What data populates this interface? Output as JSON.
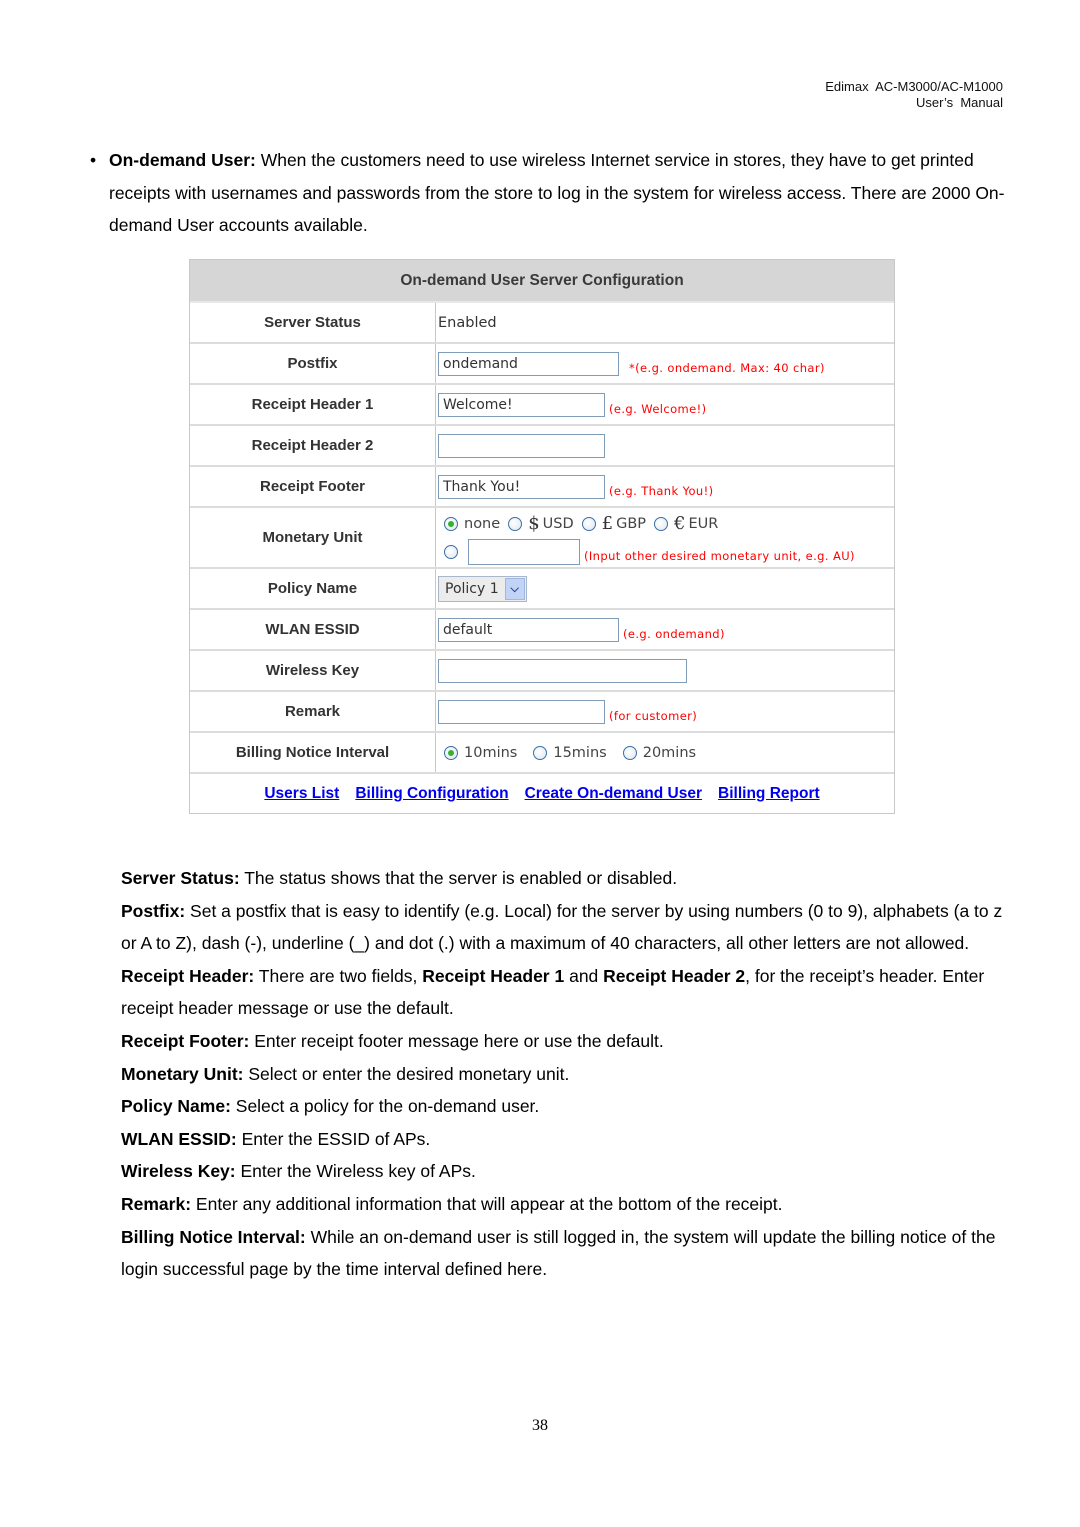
{
  "header": {
    "line1": "Edimax  AC-M3000/AC-M1000",
    "line2": "User’s  Manual"
  },
  "intro": {
    "bullet": "•",
    "term": "On-demand User:",
    "text": " When the customers need to use wireless Internet service in stores, they have to get printed receipts with usernames and passwords from the store to log in the system for wireless access. There are 2000 On-demand User accounts available."
  },
  "config": {
    "title": "On-demand User Server Configuration",
    "server_status": {
      "label": "Server Status",
      "value": "Enabled"
    },
    "postfix": {
      "label": "Postfix",
      "value": "ondemand",
      "hint": "*(e.g. ondemand. Max: 40 char)"
    },
    "receipt_header_1": {
      "label": "Receipt Header 1",
      "value": "Welcome!",
      "hint": "(e.g. Welcome!)"
    },
    "receipt_header_2": {
      "label": "Receipt Header 2",
      "value": ""
    },
    "receipt_footer": {
      "label": "Receipt Footer",
      "value": "Thank You!",
      "hint": "(e.g. Thank You!)"
    },
    "monetary_unit": {
      "label": "Monetary Unit",
      "options": [
        {
          "symbol": "",
          "label": "none",
          "selected": true
        },
        {
          "symbol": "$",
          "label": "USD",
          "selected": false
        },
        {
          "symbol": "£",
          "label": "GBP",
          "selected": false
        },
        {
          "symbol": "€",
          "label": "EUR",
          "selected": false
        }
      ],
      "other_value": "",
      "other_hint": "(Input other desired monetary unit, e.g. AU)"
    },
    "policy_name": {
      "label": "Policy Name",
      "selected": "Policy 1"
    },
    "wlan_essid": {
      "label": "WLAN ESSID",
      "value": "default",
      "hint": "(e.g. ondemand)"
    },
    "wireless_key": {
      "label": "Wireless Key",
      "value": ""
    },
    "remark": {
      "label": "Remark",
      "value": "",
      "hint": "(for customer)"
    },
    "billing_notice_interval": {
      "label": "Billing Notice Interval",
      "options": [
        {
          "label": "10mins",
          "selected": true
        },
        {
          "label": "15mins",
          "selected": false
        },
        {
          "label": "20mins",
          "selected": false
        }
      ]
    },
    "links": [
      "Users List",
      "Billing Configuration",
      "Create On-demand User",
      "Billing Report"
    ]
  },
  "descriptions": [
    {
      "term": "Server Status:",
      "text": " The status shows that the server is enabled or disabled."
    },
    {
      "term": "Postfix:",
      "text": " Set a postfix that is easy to identify (e.g. Local) for the server by using numbers (0 to 9), alphabets (a to z or A to Z), dash (-), underline (_) and dot (.) with a maximum of 40 characters, all other letters are not allowed."
    },
    {
      "term": "Receipt Header:",
      "text": " There are two fields, ",
      "term2": "Receipt Header 1",
      "text2": " and ",
      "term3": "Receipt Header 2",
      "text3": ", for the receipt’s header. Enter receipt header message or use the default."
    },
    {
      "term": "Receipt Footer:",
      "text": " Enter receipt footer message here or use the default."
    },
    {
      "term": "Monetary Unit:",
      "text": " Select or enter the desired monetary unit."
    },
    {
      "term": "Policy Name:",
      "text": " Select a policy for the on-demand user."
    },
    {
      "term": "WLAN ESSID:",
      "text": " Enter the ESSID of APs."
    },
    {
      "term": "Wireless Key:",
      "text": " Enter the Wireless key of APs."
    },
    {
      "term": "Remark:",
      "text": " Enter any additional information that will appear at the bottom of the receipt."
    },
    {
      "term": "Billing Notice Interval:",
      "text": " While an on-demand user is still logged in, the system will update the billing notice of the login successful page by the time interval defined here."
    }
  ],
  "page_number": "38"
}
